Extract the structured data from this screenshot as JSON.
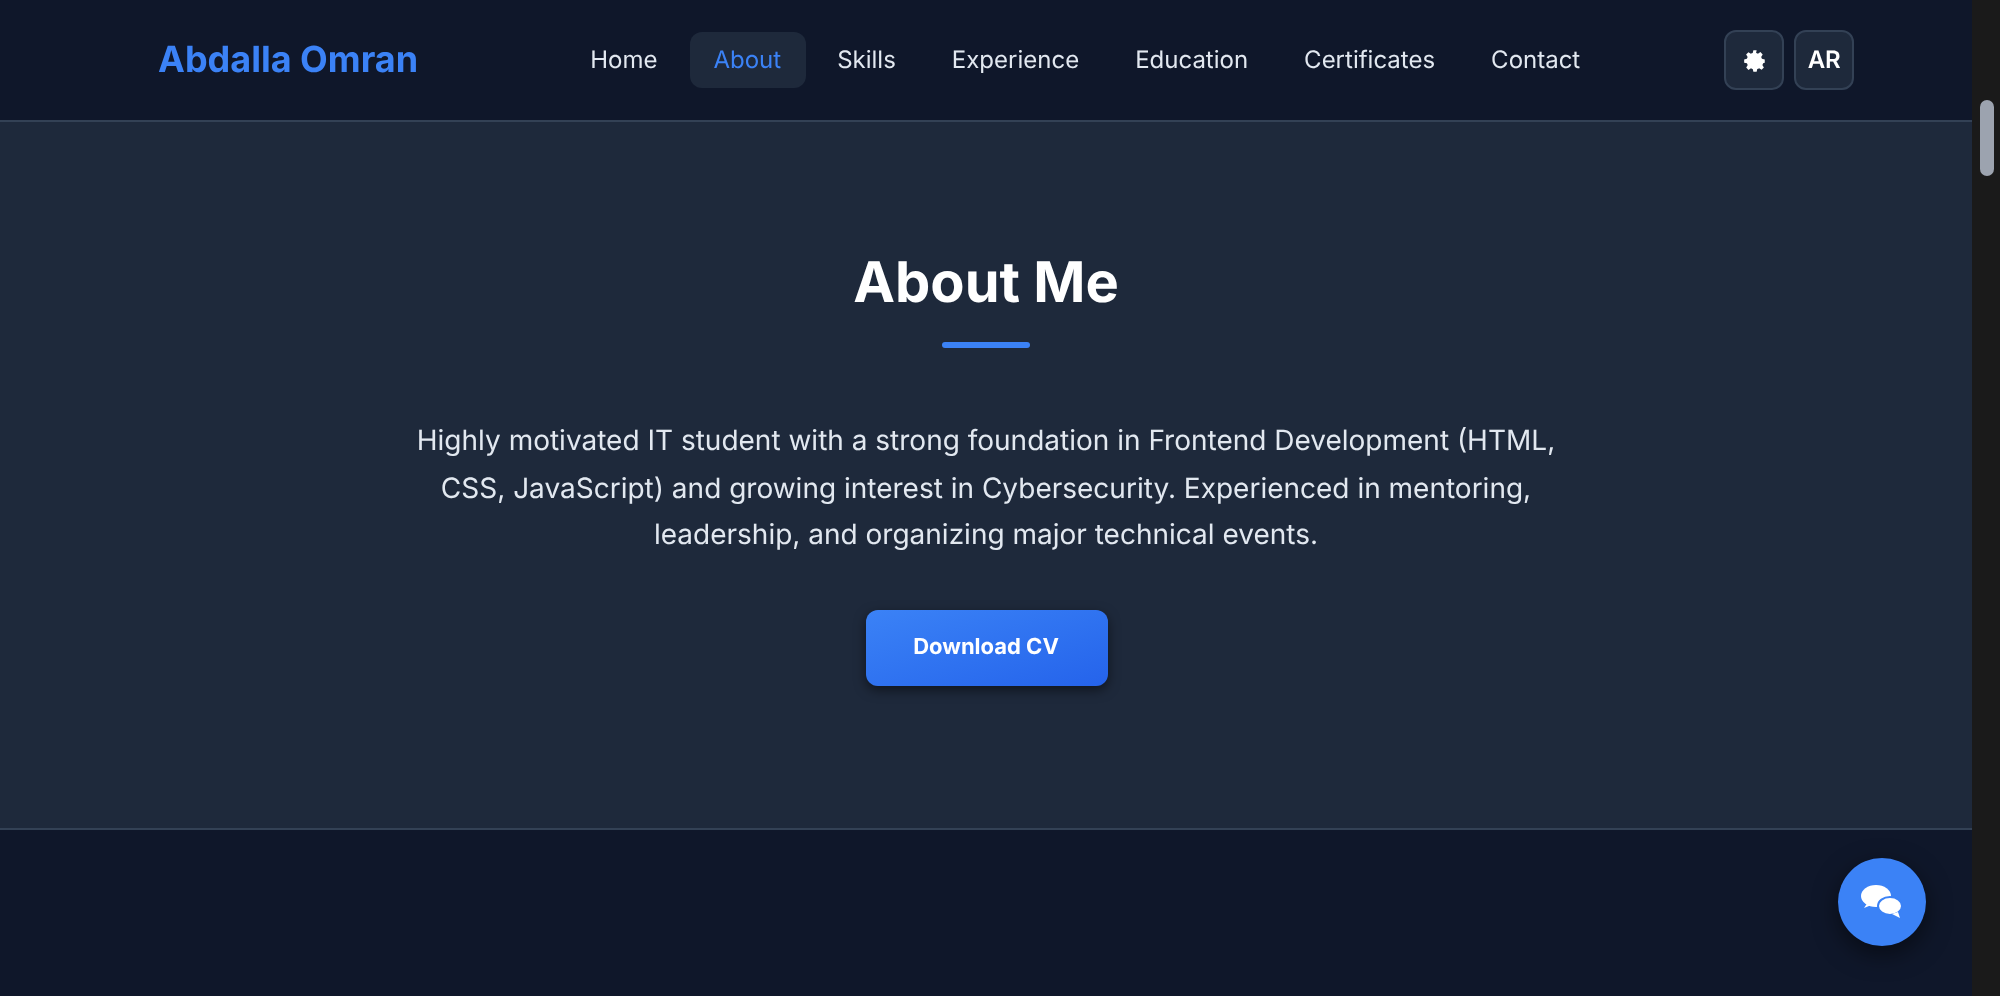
{
  "header": {
    "logo": "Abdalla Omran",
    "nav": [
      {
        "label": "Home",
        "selected": false
      },
      {
        "label": "About",
        "selected": true
      },
      {
        "label": "Skills",
        "selected": false
      },
      {
        "label": "Experience",
        "selected": false
      },
      {
        "label": "Education",
        "selected": false
      },
      {
        "label": "Certificates",
        "selected": false
      },
      {
        "label": "Contact",
        "selected": false
      }
    ],
    "language_button": "AR"
  },
  "about": {
    "title": "About Me",
    "text": "Highly motivated IT student with a strong foundation in Frontend Development (HTML, CSS, JavaScript) and growing interest in Cybersecurity. Experienced in mentoring, leadership, and organizing major technical events.",
    "button": "Download CV"
  }
}
